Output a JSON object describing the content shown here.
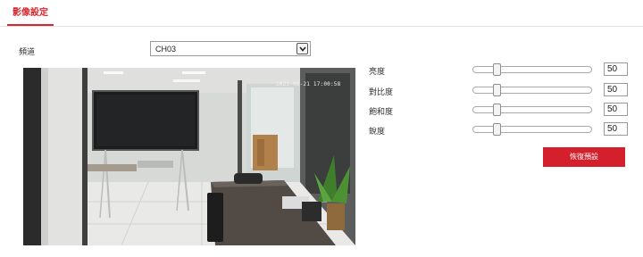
{
  "tabs": [
    {
      "label": "影像設定"
    }
  ],
  "channel": {
    "label": "頻道",
    "value": "CH03"
  },
  "preview": {
    "timestamp": "2023-06-21 17:00:58"
  },
  "adjustments": [
    {
      "label": "亮度",
      "value": "50"
    },
    {
      "label": "對比度",
      "value": "50"
    },
    {
      "label": "飽和度",
      "value": "50"
    },
    {
      "label": "銳度",
      "value": "50"
    }
  ],
  "reset_button": {
    "label": "恢復預設"
  },
  "colors": {
    "accent": "#d4202c",
    "tab_active": "#d9262e"
  }
}
